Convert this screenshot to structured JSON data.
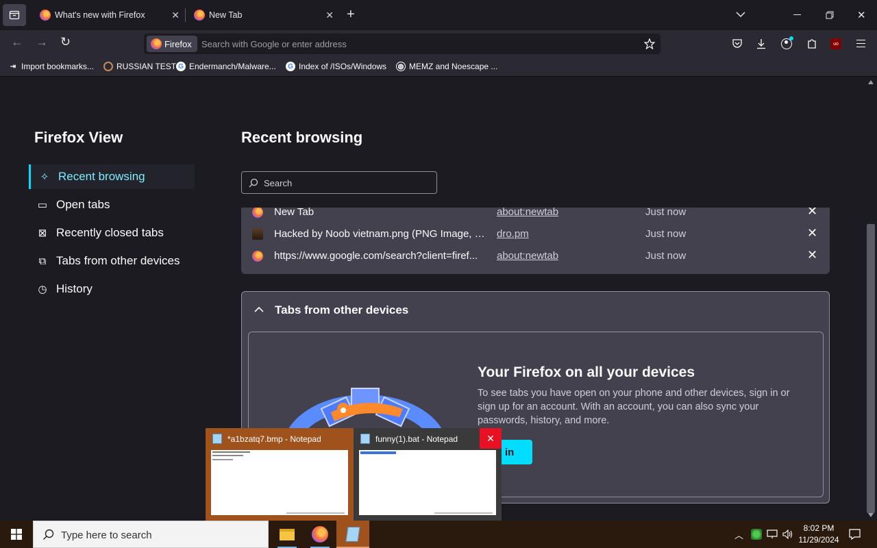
{
  "tabs": [
    {
      "title": "What's new with Firefox"
    },
    {
      "title": "New Tab"
    }
  ],
  "toolbar": {
    "identity_label": "Firefox",
    "url_placeholder": "Search with Google or enter address"
  },
  "bookmarks": [
    {
      "label": "Import bookmarks..."
    },
    {
      "label": "RUSSIAN TEST"
    },
    {
      "label": "Endermanch/Malware..."
    },
    {
      "label": "Index of /ISOs/Windows"
    },
    {
      "label": "MEMZ and Noescape ..."
    }
  ],
  "sidebar": {
    "title": "Firefox View",
    "items": [
      {
        "label": "Recent browsing"
      },
      {
        "label": "Open tabs"
      },
      {
        "label": "Recently closed tabs"
      },
      {
        "label": "Tabs from other devices"
      },
      {
        "label": "History"
      }
    ]
  },
  "main": {
    "title": "Recent browsing",
    "search_placeholder": "Search",
    "recent_rows": [
      {
        "title": "New Tab",
        "url": "about:newtab",
        "time": "Just now"
      },
      {
        "title": "Hacked by Noob vietnam.png (PNG Image, 1...",
        "url": "dro.pm",
        "time": "Just now"
      },
      {
        "title": "https://www.google.com/search?client=firef...",
        "url": "about:newtab",
        "time": "Just now"
      }
    ],
    "devices": {
      "header": "Tabs from other devices",
      "promo_title": "Your Firefox on all your devices",
      "promo_text": "To see tabs you have open on your phone and other devices, sign in or sign up for an account. With an account, you can also sync your passwords, history, and more.",
      "signin_label": "n in"
    }
  },
  "previews": [
    {
      "title": "*a1bzatq7.bmp - Notepad"
    },
    {
      "title": "funny(1).bat - Notepad"
    }
  ],
  "taskbar": {
    "search_placeholder": "Type here to search",
    "time": "8:02 PM",
    "date": "11/29/2024"
  },
  "colors": {
    "accent": "#00ddff",
    "active_text": "#80ebff",
    "preview_active": "#a0521d",
    "preview_close": "#e81123"
  }
}
